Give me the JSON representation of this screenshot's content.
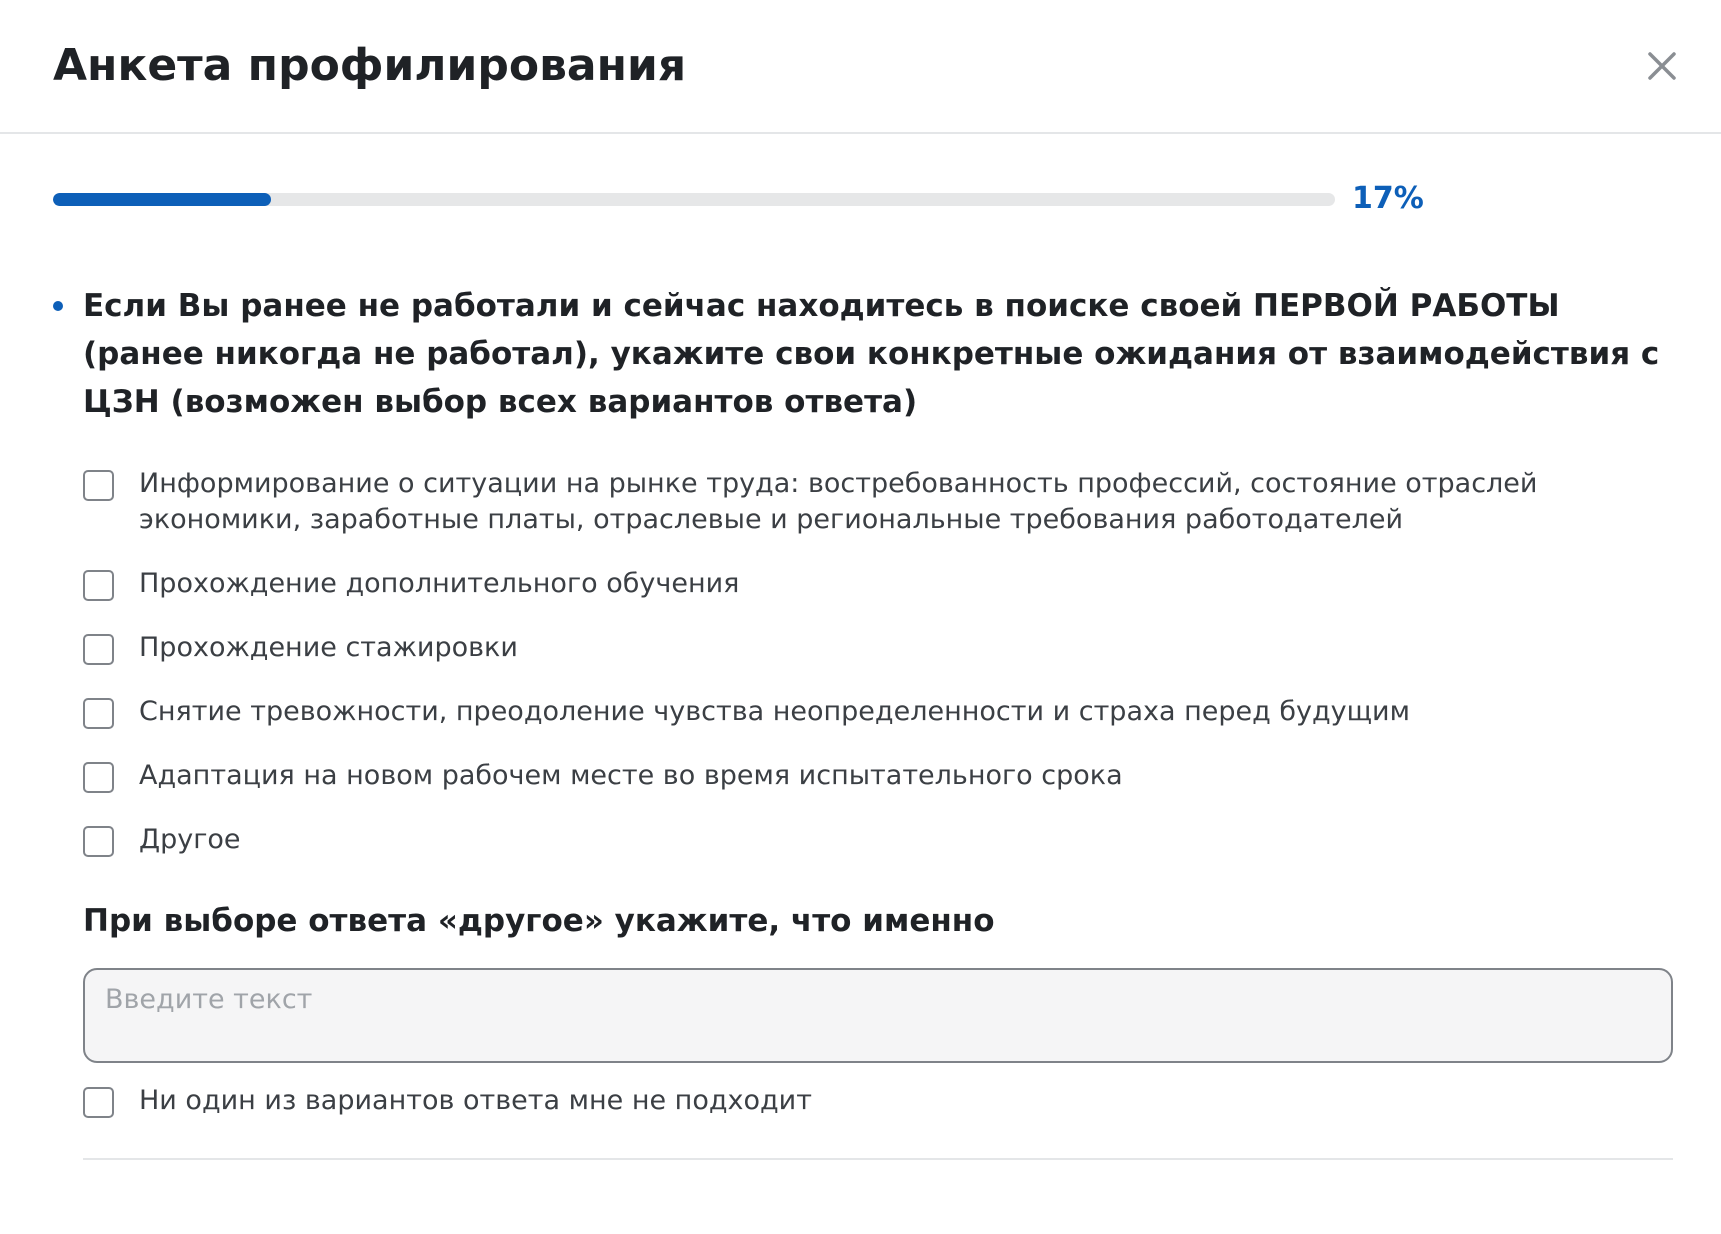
{
  "dialog": {
    "title": "Анкета профилирования",
    "close_icon": "close-icon"
  },
  "progress": {
    "percent": 17,
    "label": "17%"
  },
  "colors": {
    "accent": "#0d5fb8",
    "track": "#e6e7e8",
    "border": "#7f8389",
    "text": "#1f2226",
    "muted_text": "#3b3f44",
    "placeholder": "#a0a4a9"
  },
  "question": {
    "text": "Если Вы ранее не работали и сейчас находитесь в поиске своей ПЕРВОЙ РАБОТЫ (ранее никогда не работал), укажите свои конкретные ожидания от взаимодействия с ЦЗН (возможен выбор всех вариантов ответа)",
    "options": [
      {
        "label": "Информирование о ситуации на рынке труда: востребованность профессий, состояние отраслей экономики, заработные платы, отраслевые и региональные требования работодателей",
        "checked": false
      },
      {
        "label": "Прохождение дополнительного обучения",
        "checked": false
      },
      {
        "label": "Прохождение стажировки",
        "checked": false
      },
      {
        "label": "Снятие тревожности, преодоление чувства неопределенности и страха перед будущим",
        "checked": false
      },
      {
        "label": "Адаптация на новом рабочем месте во время испытательного срока",
        "checked": false
      },
      {
        "label": "Другое",
        "checked": false
      }
    ]
  },
  "other": {
    "title": "При выборе ответа «другое» укажите, что именно",
    "placeholder": "Введите текст",
    "value": ""
  },
  "none_option": {
    "label": "Ни один из вариантов ответа мне не подходит",
    "checked": false
  }
}
